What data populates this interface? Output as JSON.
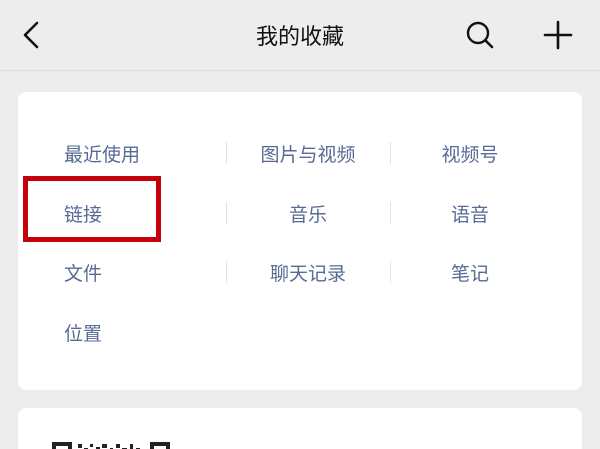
{
  "header": {
    "title": "我的收藏",
    "back_icon": "chevron-left-icon",
    "search_icon": "search-icon",
    "add_icon": "plus-icon"
  },
  "categories": [
    [
      "最近使用",
      "图片与视频",
      "视频号"
    ],
    [
      "链接",
      "音乐",
      "语音"
    ],
    [
      "文件",
      "聊天记录",
      "笔记"
    ],
    [
      "位置"
    ]
  ],
  "colors": {
    "background": "#ededed",
    "card": "#ffffff",
    "link_text": "#576b95",
    "highlight": "#c4000b"
  },
  "highlighted_item": "链接"
}
